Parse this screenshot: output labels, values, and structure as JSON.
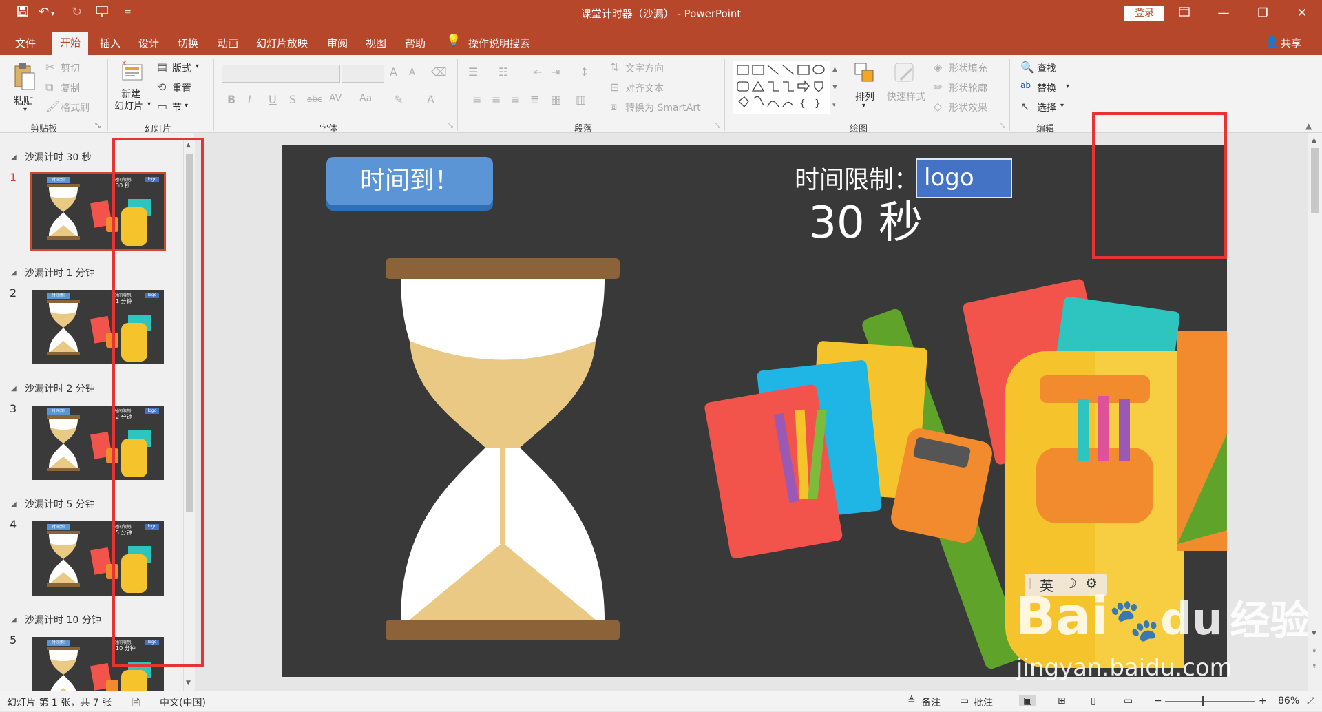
{
  "titlebar": {
    "title": "课堂计时器（沙漏） - PowerPoint",
    "login": "登录",
    "qa_icons": [
      "save-icon",
      "undo-icon",
      "redo-icon",
      "present-icon",
      "customize-icon"
    ]
  },
  "tabs": [
    "文件",
    "开始",
    "插入",
    "设计",
    "切换",
    "动画",
    "幻灯片放映",
    "审阅",
    "视图",
    "帮助"
  ],
  "tell_me": "操作说明搜索",
  "share": "共享",
  "ribbon": {
    "clipboard": {
      "paste": "粘贴",
      "cut": "剪切",
      "copy": "复制",
      "format_painter": "格式刷",
      "label": "剪贴板"
    },
    "slides": {
      "new_slide_1": "新建",
      "new_slide_2": "幻灯片",
      "layout": "版式",
      "reset": "重置",
      "section": "节",
      "label": "幻灯片"
    },
    "font": {
      "label": "字体",
      "bold": "B",
      "italic": "I",
      "underline": "U",
      "shadow": "S",
      "strike": "abc",
      "spacing": "AV",
      "case": "Aa",
      "grow": "A",
      "shrink": "A"
    },
    "paragraph": {
      "text_direction": "文字方向",
      "align_text": "对齐文本",
      "smartart": "转换为 SmartArt",
      "label": "段落"
    },
    "drawing": {
      "arrange": "排列",
      "quick_styles": "快速样式",
      "fill": "形状填充",
      "outline": "形状轮廓",
      "effects": "形状效果",
      "label": "绘图"
    },
    "editing": {
      "find": "查找",
      "replace": "替换",
      "select": "选择",
      "label": "编辑"
    }
  },
  "sections": [
    {
      "title": "沙漏计时 30 秒",
      "num": "1",
      "thumb_line1": "时间限制:",
      "thumb_line2": "30 秒"
    },
    {
      "title": "沙漏计时 1 分钟",
      "num": "2",
      "thumb_line1": "时间限制:",
      "thumb_line2": "1 分钟"
    },
    {
      "title": "沙漏计时 2 分钟",
      "num": "3",
      "thumb_line1": "时间限制:",
      "thumb_line2": "2 分钟"
    },
    {
      "title": "沙漏计时 5 分钟",
      "num": "4",
      "thumb_line1": "时间限制:",
      "thumb_line2": "5 分钟"
    },
    {
      "title": "沙漏计时 10 分钟",
      "num": "5",
      "thumb_line1": "时间限制:",
      "thumb_line2": "10 分钟"
    }
  ],
  "thumb_button": "时间到!",
  "thumb_logo": "logo",
  "slide": {
    "time_button": "时间到！",
    "limit_label": "时间限制：",
    "limit_value": "30 秒",
    "logo": "logo"
  },
  "ime": {
    "lang": "英",
    "moon": "☽",
    "gear": "⚙"
  },
  "watermark": {
    "text_main": "Bai",
    "text_sub": "du",
    "text_cn": "经验",
    "url": "jingyan.baidu.com"
  },
  "status": {
    "slide_info": "幻灯片 第 1 张，共 7 张",
    "language": "中文(中国)",
    "notes": "备注",
    "comments": "批注",
    "zoom": "86%"
  },
  "colors": {
    "accent": "#b7472a",
    "annotation": "#e63434",
    "slide_bg": "#393939",
    "button_blue": "#5b95d5",
    "logo_blue": "#4472c4"
  }
}
